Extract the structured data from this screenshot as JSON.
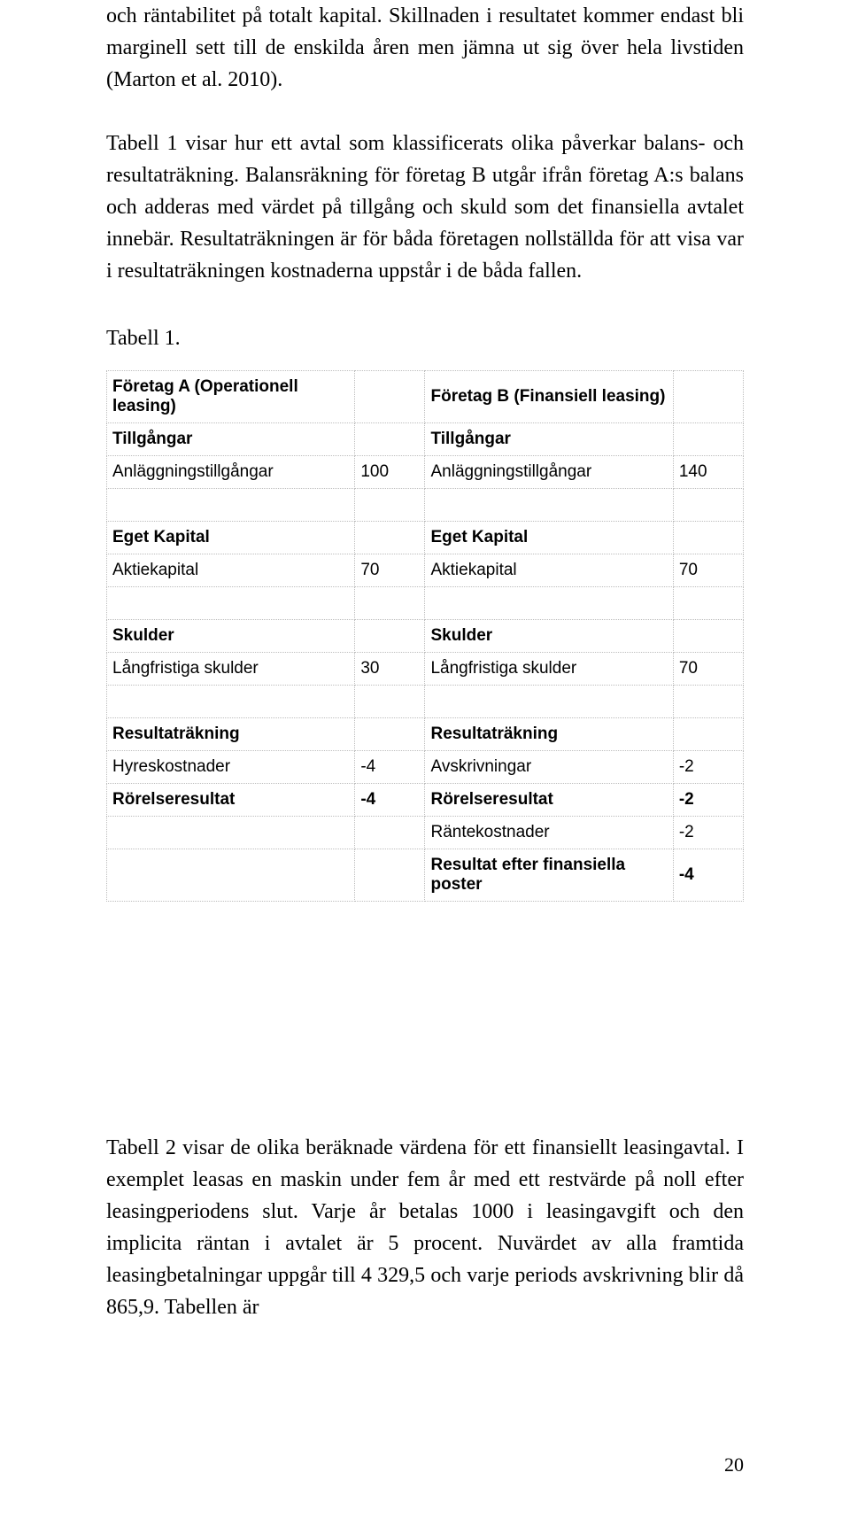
{
  "paragraphs": {
    "p1": "och räntabilitet på totalt kapital. Skillnaden i resultatet kommer endast bli marginell sett till de enskilda åren men jämna ut sig över hela livstiden (Marton et al. 2010).",
    "p2": "Tabell 1 visar hur ett avtal som klassificerats olika påverkar balans- och resultaträkning. Balansräkning för företag B utgår ifrån företag A:s balans och adderas med värdet på tillgång och skuld som det finansiella avtalet innebär. Resultaträkningen är för båda företagen nollställda för att visa var i resultaträkningen kostnaderna uppstår i de båda fallen.",
    "caption1": "Tabell 1.",
    "p3": "Tabell 2 visar de olika beräknade värdena för ett finansiellt leasingavtal. I exemplet leasas en maskin under fem år med ett restvärde på noll efter leasingperiodens slut. Varje år betalas 1000 i leasingavgift och den implicita räntan i avtalet är 5 procent. Nuvärdet av alla framtida leasingbetalningar uppgår till 4 329,5 och varje periods avskrivning blir då 865,9. Tabellen är"
  },
  "table": {
    "rows": [
      {
        "a_label": "Företag A (Operationell leasing)",
        "a_val": "",
        "b_label": "Företag B (Finansiell leasing)",
        "b_val": "",
        "a_bold": true,
        "b_bold": true
      },
      {
        "a_label": "Tillgångar",
        "a_val": "",
        "b_label": "Tillgångar",
        "b_val": "",
        "a_bold": true,
        "b_bold": true
      },
      {
        "a_label": "Anläggningstillgångar",
        "a_val": "100",
        "b_label": "Anläggningstillgångar",
        "b_val": "140",
        "a_bold": false,
        "b_bold": false
      },
      {
        "blank": true
      },
      {
        "a_label": "Eget Kapital",
        "a_val": "",
        "b_label": "Eget Kapital",
        "b_val": "",
        "a_bold": true,
        "b_bold": true
      },
      {
        "a_label": "Aktiekapital",
        "a_val": "70",
        "b_label": "Aktiekapital",
        "b_val": "70",
        "a_bold": false,
        "b_bold": false
      },
      {
        "blank": true
      },
      {
        "a_label": "Skulder",
        "a_val": "",
        "b_label": "Skulder",
        "b_val": "",
        "a_bold": true,
        "b_bold": true
      },
      {
        "a_label": "Långfristiga skulder",
        "a_val": "30",
        "b_label": "Långfristiga skulder",
        "b_val": "70",
        "a_bold": false,
        "b_bold": false
      },
      {
        "blank": true
      },
      {
        "a_label": "Resultaträkning",
        "a_val": "",
        "b_label": "Resultaträkning",
        "b_val": "",
        "a_bold": true,
        "b_bold": true
      },
      {
        "a_label": "Hyreskostnader",
        "a_val": "-4",
        "b_label": "Avskrivningar",
        "b_val": "-2",
        "a_bold": false,
        "b_bold": false
      },
      {
        "a_label": "Rörelseresultat",
        "a_val": "-4",
        "b_label": "Rörelseresultat",
        "b_val": "-2",
        "a_bold": true,
        "b_bold": true
      },
      {
        "a_label": "",
        "a_val": "",
        "b_label": "Räntekostnader",
        "b_val": "-2",
        "a_bold": false,
        "b_bold": false
      },
      {
        "a_label": "",
        "a_val": "",
        "b_label": "Resultat efter finansiella poster",
        "b_val": "-4",
        "a_bold": false,
        "b_bold": true
      }
    ]
  },
  "page_number": "20"
}
